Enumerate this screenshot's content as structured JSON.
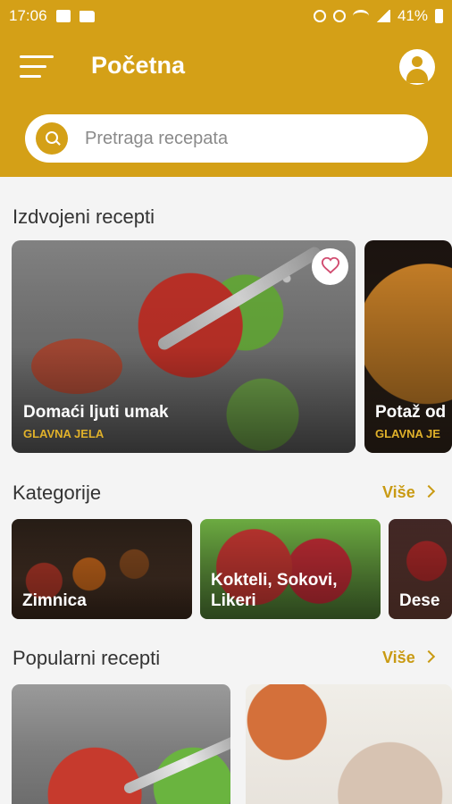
{
  "status_bar": {
    "time": "17:06",
    "battery": "41%",
    "icons": [
      "gallery-icon",
      "folder-icon",
      "alarm-icon",
      "mute-icon",
      "wifi-icon",
      "signal-icon",
      "battery-icon"
    ]
  },
  "header": {
    "title": "Početna",
    "search_placeholder": "Pretraga recepata",
    "accent_color": "#d4a017"
  },
  "featured": {
    "title": "Izdvojeni recepti",
    "items": [
      {
        "name": "Domaći ljuti umak",
        "category": "GLAVNA JELA",
        "favorite": false
      },
      {
        "name": "Potaž od",
        "category": "GLAVNA JE"
      }
    ]
  },
  "categories": {
    "title": "Kategorije",
    "more": "Više",
    "items": [
      "Zimnica",
      "Kokteli, Sokovi,\nLikeri",
      "Dese"
    ]
  },
  "popular": {
    "title": "Popularni recepti",
    "more": "Više"
  }
}
